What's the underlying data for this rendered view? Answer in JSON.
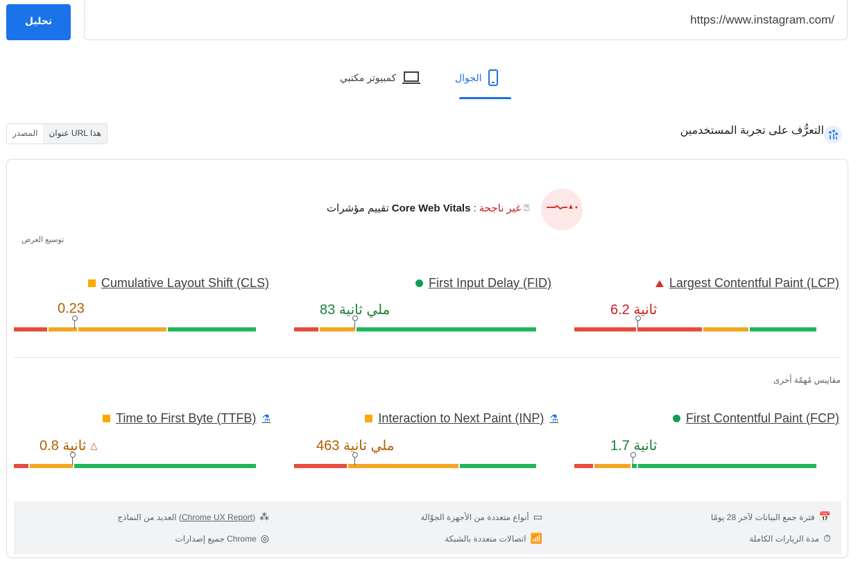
{
  "toolbar": {
    "analyze_label": "تحليل",
    "url_value": "https://www.instagram.com/"
  },
  "tabs": {
    "mobile_label": "الجوال",
    "desktop_label": "كمبيوتر مكتبي"
  },
  "section": {
    "title": "التعرُّف على تجربة المستخدمين",
    "source_url_label": "عنوان URL هذا",
    "source_origin_label": "المصدر"
  },
  "cwv": {
    "label": "تقييم مؤشرات",
    "brand": "Core Web Vitals",
    "status": "غير ناجحة",
    "expand_label": "توسيع العرض"
  },
  "metrics": [
    {
      "name": "Largest Contentful Paint (LCP)",
      "value": "6.2 ثانية",
      "status": "poor",
      "bar": [
        0.26,
        0.27,
        0.19,
        0.28
      ],
      "marker": 0.26
    },
    {
      "name": "First Input Delay (FID)",
      "value": "83 ملي ثانية",
      "status": "good",
      "bar": [
        0.1,
        0.15,
        0.75
      ],
      "marker": 0.25
    },
    {
      "name": "Cumulative Layout Shift (CLS)",
      "value": "0.23",
      "status": "needs-improvement",
      "bar": [
        0.14,
        0.12,
        0.37,
        0.37
      ],
      "marker": 0.25
    }
  ],
  "other_metrics_label": "مقاييس مُهمّة أخرى",
  "other_metrics": [
    {
      "name": "First Contentful Paint (FCP)",
      "value": "1.7 ثانية",
      "status": "good",
      "bar": [
        0.08,
        0.15,
        0.02,
        0.75
      ],
      "marker": 0.24
    },
    {
      "name": "Interaction to Next Paint (INP)",
      "value": "463 ملي ثانية",
      "status": "needs-improvement",
      "bar": [
        0.22,
        0.46,
        0.32
      ],
      "marker": 0.25
    },
    {
      "name": "Time to First Byte (TTFB)",
      "value": "0.8 ثانية",
      "status": "needs-improvement",
      "bar": [
        0.06,
        0.18,
        0.76
      ],
      "marker": 0.24
    }
  ],
  "info": {
    "collection_period": "فترة جمع البيانات لآخر 28 يومًا",
    "devices": "أنواع متعددة من الأجهزة الجوّالة",
    "samples_prefix": "العديد من النماذج",
    "samples_link": "(Chrome UX Report)",
    "visit_duration": "مدة الزيارات الكاملة",
    "network": "اتصالات متعددة بالشبكة",
    "chrome_versions": "جميع إصدارات Chrome"
  },
  "colors": {
    "accent": "#1a73e8",
    "poor": "#e74c3c",
    "needs_improvement": "#f4a623",
    "good": "#20b85a"
  }
}
